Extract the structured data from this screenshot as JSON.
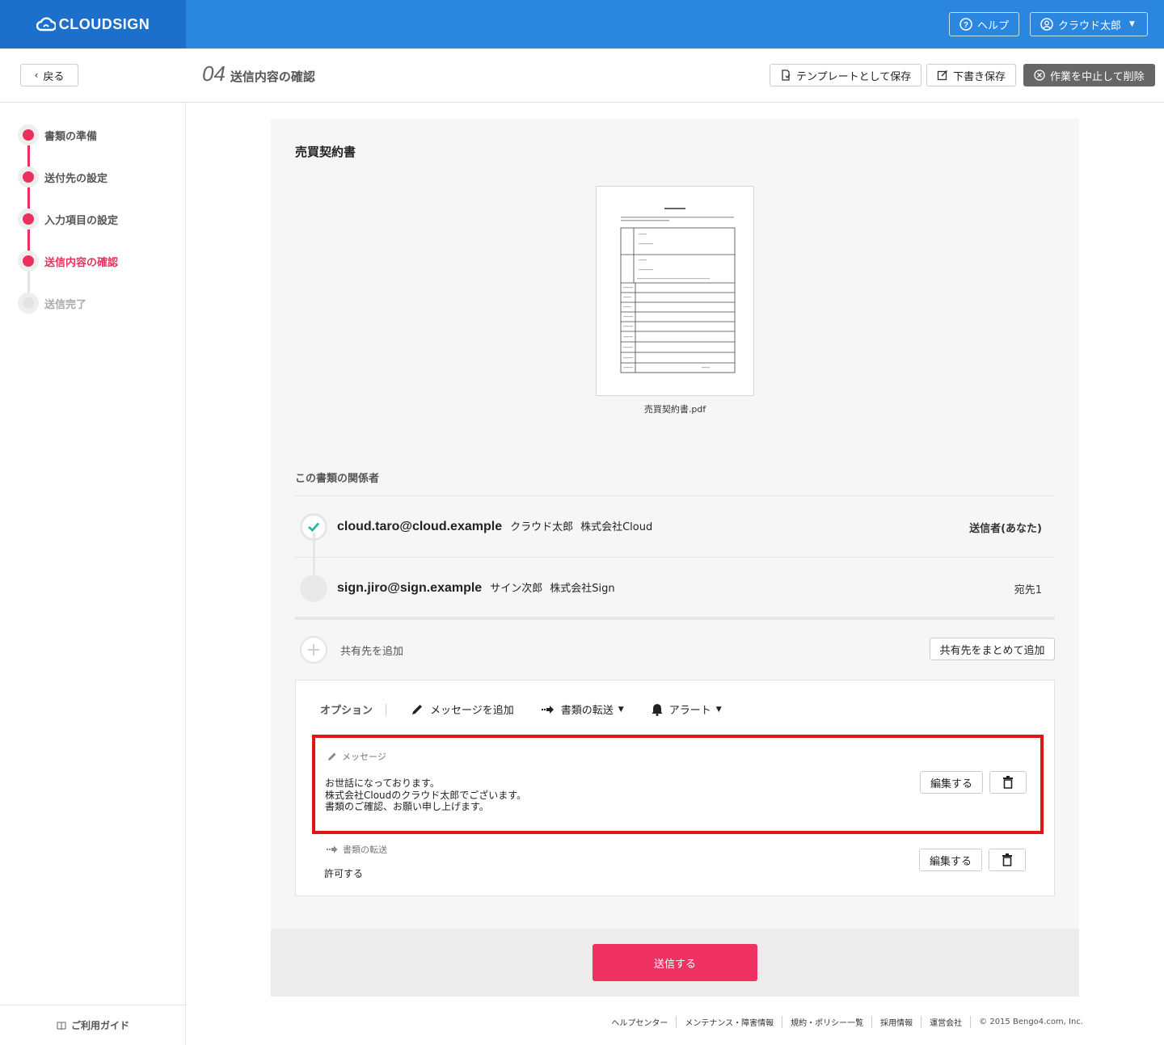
{
  "header": {
    "logo": "CLOUDSIGN",
    "help_label": "ヘルプ",
    "user_label": "クラウド太郎"
  },
  "subheader": {
    "back_label": "戻る",
    "step_number": "04",
    "title": "送信内容の確認",
    "save_template_label": "テンプレートとして保存",
    "save_draft_label": "下書き保存",
    "cancel_delete_label": "作業を中止して削除"
  },
  "sidebar": {
    "steps": [
      {
        "label": "書類の準備",
        "state": "done"
      },
      {
        "label": "送付先の設定",
        "state": "done"
      },
      {
        "label": "入力項目の設定",
        "state": "done"
      },
      {
        "label": "送信内容の確認",
        "state": "active"
      },
      {
        "label": "送信完了",
        "state": "pending"
      }
    ],
    "guide_label": "ご利用ガイド"
  },
  "document": {
    "title": "売買契約書",
    "file_name": "売買契約書.pdf"
  },
  "participants": {
    "section_title": "この書類の関係者",
    "rows": [
      {
        "email": "cloud.taro@cloud.example",
        "name": "クラウド太郎",
        "org": "株式会社Cloud",
        "role": "送信者(あなた)"
      },
      {
        "email": "sign.jiro@sign.example",
        "name": "サイン次郎",
        "org": "株式会社Sign",
        "role": "宛先1"
      }
    ],
    "add_share_label": "共有先を追加",
    "bulk_add_label": "共有先をまとめて追加"
  },
  "options": {
    "label": "オプション",
    "add_message_label": "メッセージを追加",
    "transfer_label": "書類の転送",
    "alert_label": "アラート",
    "message_section": {
      "label": "メッセージ",
      "lines": [
        "お世話になっております。",
        "株式会社Cloudのクラウド太郎でございます。",
        "書類のご確認、お願い申し上げます。"
      ],
      "edit_label": "編集する"
    },
    "transfer_section": {
      "label": "書類の転送",
      "value": "許可する",
      "edit_label": "編集する"
    }
  },
  "send_label": "送信する",
  "footer": {
    "links": [
      "ヘルプセンター",
      "メンテナンス・障害情報",
      "規約・ポリシー一覧",
      "採用情報",
      "運営会社"
    ],
    "copyright": "© 2015 Bengo4.com, Inc."
  },
  "colors": {
    "header_blue": "#2b86e0",
    "logo_blue": "#1d6fcc",
    "accent_pink": "#e8325c",
    "send_button": "#f03263",
    "highlight_red": "#e01515",
    "check_teal": "#2bb5a5"
  }
}
